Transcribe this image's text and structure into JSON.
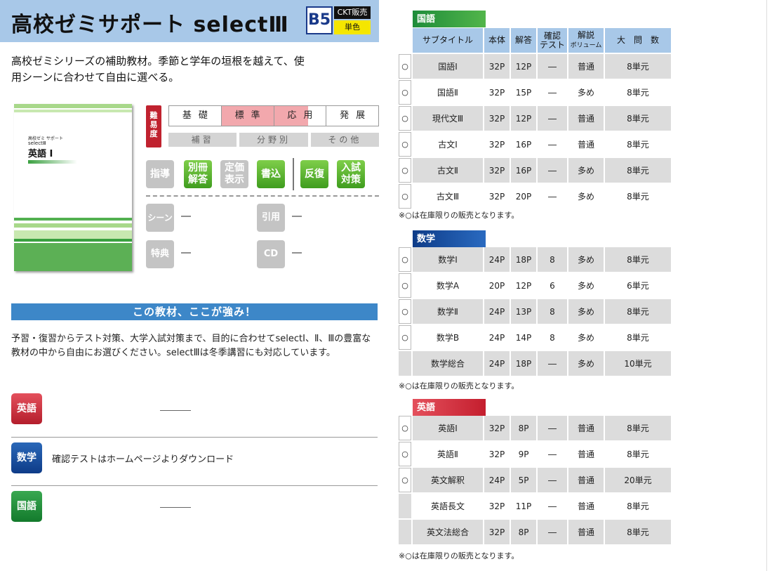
{
  "header": {
    "title": "高校ゼミサポート selectⅢ",
    "size": "B5",
    "sales": "CKT販売",
    "color": "単色"
  },
  "intro": [
    "高校ゼミシリーズの補助教材。季節と学年の垣根を越えて、使",
    "用シーンに合わせて自由に選べる。"
  ],
  "cover": {
    "series": "高校ゼミ サポート",
    "select": "selectⅢ",
    "subject": "英語 Ⅰ"
  },
  "difficulty": {
    "badge": "難易度",
    "levels": [
      {
        "label": "基礎",
        "active": false
      },
      {
        "label": "標準",
        "active": true
      },
      {
        "label": "応用",
        "active": true
      },
      {
        "label": "発展",
        "active": false
      }
    ],
    "subs": [
      "補習",
      "分野別",
      "その他"
    ]
  },
  "features": [
    {
      "label": "指導",
      "on": false
    },
    {
      "label": "別冊解答",
      "on": true
    },
    {
      "label": "定価表示",
      "on": false
    },
    {
      "label": "書込",
      "on": true
    },
    {
      "label": "反復",
      "on": true
    },
    {
      "label": "入試対策",
      "on": true
    }
  ],
  "info": {
    "scene": {
      "label": "シーン",
      "value": "―"
    },
    "quote": {
      "label": "引用",
      "value": "―"
    },
    "bonus": {
      "label": "特典",
      "value": "―"
    },
    "cd": {
      "label": "CD",
      "value": "―"
    }
  },
  "strengths": {
    "title": "この教材、ここが強み！",
    "text": "予習・復習からテスト対策、大学入試対策まで、目的に合わせてselectⅠ、Ⅱ、Ⅲの豊富な教材の中から自由にお選びください。selectⅢは冬季講習にも対応しています。"
  },
  "subjects": [
    {
      "label": "英語",
      "note": ""
    },
    {
      "label": "数学",
      "note": "確認テストはホームページよりダウンロード"
    },
    {
      "label": "国語",
      "note": ""
    }
  ],
  "table_headers": {
    "subtitle": "サブタイトル",
    "pages": "本体",
    "answer": "解答",
    "test1": "確認",
    "test2": "テスト",
    "vol1": "解説",
    "vol2": "ボリューム",
    "units": "大　問　数"
  },
  "note": "※○は在庫限りの販売となります。",
  "sections": [
    {
      "name": "国語",
      "rows": [
        {
          "mark": "○",
          "title": "国語Ⅰ",
          "pages": "32P",
          "answer": "12P",
          "test": "―",
          "volume": "普通",
          "units": "8単元"
        },
        {
          "mark": "○",
          "title": "国語Ⅱ",
          "pages": "32P",
          "answer": "15P",
          "test": "―",
          "volume": "多め",
          "units": "8単元"
        },
        {
          "mark": "○",
          "title": "現代文Ⅲ",
          "pages": "32P",
          "answer": "12P",
          "test": "―",
          "volume": "普通",
          "units": "8単元"
        },
        {
          "mark": "○",
          "title": "古文Ⅰ",
          "pages": "32P",
          "answer": "16P",
          "test": "―",
          "volume": "普通",
          "units": "8単元"
        },
        {
          "mark": "○",
          "title": "古文Ⅱ",
          "pages": "32P",
          "answer": "16P",
          "test": "―",
          "volume": "多め",
          "units": "8単元"
        },
        {
          "mark": "○",
          "title": "古文Ⅲ",
          "pages": "32P",
          "answer": "20P",
          "test": "―",
          "volume": "多め",
          "units": "8単元"
        }
      ]
    },
    {
      "name": "数学",
      "rows": [
        {
          "mark": "○",
          "title": "数学Ⅰ",
          "pages": "24P",
          "answer": "18P",
          "test": "8",
          "volume": "多め",
          "units": "8単元"
        },
        {
          "mark": "○",
          "title": "数学A",
          "pages": "20P",
          "answer": "12P",
          "test": "6",
          "volume": "多め",
          "units": "6単元"
        },
        {
          "mark": "○",
          "title": "数学Ⅱ",
          "pages": "24P",
          "answer": "13P",
          "test": "8",
          "volume": "多め",
          "units": "8単元"
        },
        {
          "mark": "○",
          "title": "数学B",
          "pages": "24P",
          "answer": "14P",
          "test": "8",
          "volume": "多め",
          "units": "8単元"
        },
        {
          "mark": "",
          "title": "数学総合",
          "pages": "24P",
          "answer": "18P",
          "test": "―",
          "volume": "多め",
          "units": "10単元"
        }
      ]
    },
    {
      "name": "英語",
      "rows": [
        {
          "mark": "○",
          "title": "英語Ⅰ",
          "pages": "32P",
          "answer": "8P",
          "test": "―",
          "volume": "普通",
          "units": "8単元"
        },
        {
          "mark": "○",
          "title": "英語Ⅱ",
          "pages": "32P",
          "answer": "9P",
          "test": "―",
          "volume": "普通",
          "units": "8単元"
        },
        {
          "mark": "○",
          "title": "英文解釈",
          "pages": "24P",
          "answer": "5P",
          "test": "―",
          "volume": "普通",
          "units": "20単元"
        },
        {
          "mark": "",
          "title": "英語長文",
          "pages": "32P",
          "answer": "11P",
          "test": "―",
          "volume": "普通",
          "units": "8単元"
        },
        {
          "mark": "",
          "title": "英文法総合",
          "pages": "32P",
          "answer": "8P",
          "test": "―",
          "volume": "普通",
          "units": "8単元"
        }
      ]
    }
  ]
}
